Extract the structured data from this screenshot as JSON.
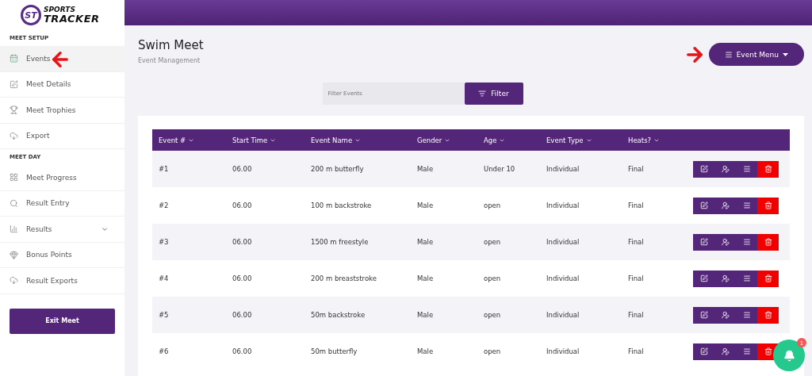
{
  "logo": {
    "mark": "ST",
    "line1": "SPORTS",
    "line2": "TRACKER"
  },
  "sidebar": {
    "sections": [
      {
        "title": "MEET SETUP",
        "items": [
          {
            "label": "Events",
            "kind": "calendar",
            "selected": true,
            "pointer": true
          },
          {
            "label": "Meet Details",
            "kind": "edit",
            "selected": false
          },
          {
            "label": "Meet Trophies",
            "kind": "trophy",
            "selected": false
          },
          {
            "label": "Export",
            "kind": "cloud",
            "selected": false
          }
        ]
      },
      {
        "title": "MEET DAY",
        "items": [
          {
            "label": "Meet Progress",
            "kind": "grid",
            "selected": false
          },
          {
            "label": "Result Entry",
            "kind": "search",
            "selected": false
          },
          {
            "label": "Results",
            "kind": "chart",
            "selected": false,
            "expandable": true
          },
          {
            "label": "Bonus Points",
            "kind": "gem",
            "selected": false
          },
          {
            "label": "Result Exports",
            "kind": "cloud",
            "selected": false
          }
        ]
      }
    ],
    "exit_button": "Exit Meet"
  },
  "header": {
    "title": "Swim Meet",
    "subtitle": "Event Management",
    "menu_button": "Event Menu",
    "pointer": true
  },
  "filter": {
    "placeholder": "Filter Events",
    "button": "Filter"
  },
  "table": {
    "columns": [
      "Event #",
      "Start Time",
      "Event Name",
      "Gender",
      "Age",
      "Event Type",
      "Heats?"
    ],
    "rows": [
      [
        "#1",
        "06.00",
        "200 m butterfly",
        "Male",
        "Under 10",
        "Individual",
        "Final"
      ],
      [
        "#2",
        "06.00",
        "100 m backstroke",
        "Male",
        "open",
        "Individual",
        "Final"
      ],
      [
        "#3",
        "06.00",
        "1500 m freestyle",
        "Male",
        "open",
        "Individual",
        "Final"
      ],
      [
        "#4",
        "06.00",
        "200 m breaststroke",
        "Male",
        "open",
        "Individual",
        "Final"
      ],
      [
        "#5",
        "06.00",
        "50m backstroke",
        "Male",
        "open",
        "Individual",
        "Final"
      ],
      [
        "#6",
        "06.00",
        "50m butterfly",
        "Male",
        "open",
        "Individual",
        "Final"
      ]
    ]
  },
  "notifications": {
    "count": "1"
  }
}
